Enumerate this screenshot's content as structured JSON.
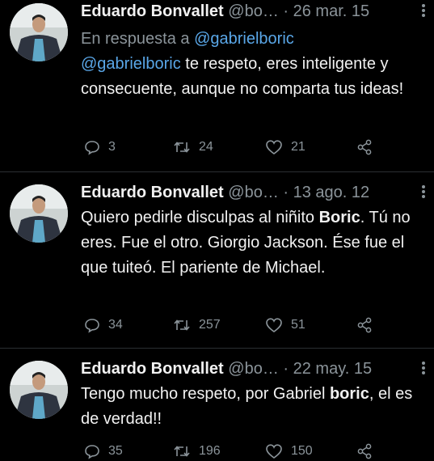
{
  "tweets": [
    {
      "name": "Eduardo Bonvallet",
      "handle": "@bo…",
      "separator": "·",
      "date": "26 mar. 15",
      "reply_prefix": "En respuesta a",
      "reply_to": "@gabrielboric",
      "body_mention": "@gabrielboric",
      "body_text": " te respeto, eres inteligente y consecuente, aunque no comparta tus ideas!",
      "replies": "3",
      "retweets": "24",
      "likes": "21"
    },
    {
      "name": "Eduardo Bonvallet",
      "handle": "@bo…",
      "separator": "·",
      "date": "13 ago. 12",
      "body_pre": "Quiero pedirle disculpas al niñito ",
      "body_bold": "Boric",
      "body_post": ". Tú no eres. Fue el otro. Giorgio Jackson. Ése fue el que tuiteó. El pariente de Michael.",
      "replies": "34",
      "retweets": "257",
      "likes": "51"
    },
    {
      "name": "Eduardo Bonvallet",
      "handle": "@bo…",
      "separator": "·",
      "date": "22 may. 15",
      "body_pre": "Tengo mucho respeto, por Gabriel ",
      "body_bold": "boric",
      "body_post": ", el es de verdad!!",
      "replies": "35",
      "retweets": "196",
      "likes": "150"
    }
  ],
  "icons": {
    "reply": "reply-icon",
    "retweet": "retweet-icon",
    "like": "heart-icon",
    "share": "share-icon",
    "more": "more-vertical-icon"
  },
  "colors": {
    "background": "#000000",
    "text": "#e7e9ea",
    "muted": "#8b949a",
    "mention": "#5aa7e8"
  }
}
